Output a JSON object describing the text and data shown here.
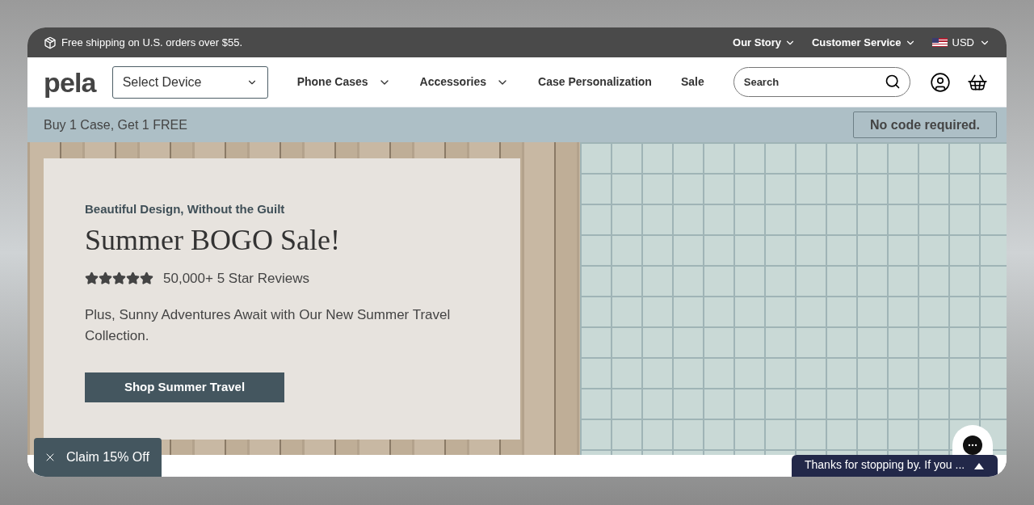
{
  "top_bar": {
    "shipping": "Free shipping on U.S. orders over $55.",
    "links": [
      {
        "label": "Our Story"
      },
      {
        "label": "Customer Service"
      }
    ],
    "currency": "USD"
  },
  "nav": {
    "logo": "pela",
    "device_select": "Select Device",
    "items": [
      {
        "label": "Phone Cases",
        "dropdown": true
      },
      {
        "label": "Accessories",
        "dropdown": true
      },
      {
        "label": "Case Personalization",
        "dropdown": false
      },
      {
        "label": "Sale",
        "dropdown": false
      }
    ],
    "search": {
      "placeholder": "Search"
    }
  },
  "promo_bar": {
    "text": "Buy 1 Case, Get 1 FREE",
    "badge": "No code required."
  },
  "hero": {
    "eyebrow": "Beautiful Design, Without the Guilt",
    "title": "Summer BOGO Sale!",
    "stars": 5,
    "reviews": "50,000+ 5 Star Reviews",
    "body": "Plus, Sunny Adventures Await with Our New Summer Travel Collection.",
    "button": "Shop Summer Travel"
  },
  "claim_button": "Claim 15% Off",
  "chat": {
    "message": "Thanks for stopping by. If you ..."
  }
}
